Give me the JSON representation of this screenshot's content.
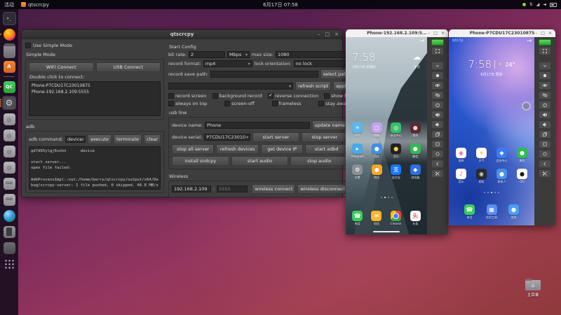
{
  "topbar": {
    "activities": "活动",
    "app_name": "qtscrcpy",
    "clock": "6月17日 07:58"
  },
  "window_controls": {
    "minimize": "–",
    "maximize": "□",
    "close": "×"
  },
  "dock": {
    "items": [
      {
        "name": "terminal",
        "base": "terminal",
        "text": ">_"
      },
      {
        "name": "firefox",
        "base": "firefox",
        "dots": 1
      },
      {
        "name": "files",
        "base": "files"
      },
      {
        "name": "software",
        "base": "software",
        "text": "A"
      },
      {
        "name": "separator"
      },
      {
        "name": "qtcreator",
        "base": "qtcreator",
        "text": "QC",
        "dots": 1
      },
      {
        "name": "qtscrcpy",
        "base": "qtscrcpy",
        "text": "⚙",
        "active": true,
        "dots": 4
      },
      {
        "name": "disk-1",
        "base": "disk",
        "text": "◎"
      },
      {
        "name": "disk-2",
        "base": "disk",
        "text": "◎"
      },
      {
        "name": "disk-3",
        "base": "disk",
        "text": "◎"
      },
      {
        "name": "disk-4",
        "base": "disk",
        "text": "◎"
      },
      {
        "name": "ssd-1",
        "base": "ssd",
        "text": "SSD"
      },
      {
        "name": "ssd-2",
        "base": "ssd",
        "text": "SSD"
      },
      {
        "name": "globe",
        "base": "globe"
      },
      {
        "name": "phone-device",
        "base": "phonedev"
      },
      {
        "name": "drive",
        "base": "drive"
      },
      {
        "name": "show-apps",
        "base": "apps"
      }
    ]
  },
  "desktop": {
    "home_folder_label": "主目录"
  },
  "main_window": {
    "title": "qtscrcpy",
    "left": {
      "use_simple_mode": "Use Simple Mode",
      "simple_mode": "Simple Mode",
      "wifi_connect": "WIFI Connect",
      "usb_connect": "USB Connect",
      "double_click_hint": "Double click to connect:",
      "device_list": [
        "Phone-P7CDU17C23010875",
        "Phone-192.168.2.109:5555"
      ],
      "adb_title": "adb",
      "adb_command_label": "adb command:",
      "adb_command_value": "devices",
      "execute": "execute",
      "terminate": "terminate",
      "clear": "clear",
      "log": [
        "gd7d65ylgj6xnhn      device",
        "",
        "start server...",
        "open file failed:",
        "",
        "AdbProcessImpl::out:/home/barry/qtscrcpy/output/x64/Debug/scrcpy-server: 1 file pushed, 0 skipped. 46.8 MB/s (40667 bytes in 0.001s)"
      ]
    },
    "right": {
      "start_config": "Start Config",
      "bit_rate_label": "bit rate:",
      "bit_rate_value": "2",
      "bit_rate_unit": "Mbps",
      "max_size_label": "max size:",
      "max_size_value": "1080",
      "record_format_label": "record format:",
      "record_format_value": "mp4",
      "lock_orientation_label": "lock orientation:",
      "lock_orientation_value": "no lock",
      "record_save_path_label": "record save path:",
      "record_save_path_value": "",
      "select_path": "select path",
      "script_combo_value": "",
      "refresh_script": "refresh script",
      "apply": "apply",
      "checks1": [
        {
          "label": "record screen",
          "checked": false
        },
        {
          "label": "background record",
          "checked": false
        },
        {
          "label": "reverse connection",
          "checked": true
        },
        {
          "label": "show fps",
          "checked": false
        }
      ],
      "checks2": [
        {
          "label": "always on top",
          "checked": false
        },
        {
          "label": "screen-off",
          "checked": false
        },
        {
          "label": "frameless",
          "checked": false
        },
        {
          "label": "stay awake",
          "checked": false
        }
      ],
      "usb_line": "usb line",
      "device_name_label": "device name:",
      "device_name_value": "Phone",
      "update_name": "update name",
      "device_serial_label": "device serial:",
      "device_serial_value": "P7CDU17C23010",
      "start_server": "start server",
      "stop_server": "stop server",
      "stop_all_server": "stop all server",
      "refresh_devices": "refresh devices",
      "get_device_ip": "get device IP",
      "start_adbd": "start adbd",
      "install_sndcpy": "install sndcpy",
      "start_audio": "start audio",
      "stop_audio": "stop audio",
      "wireless_title": "Wireless",
      "ip_value": "192.168.2.109",
      "colon": ":",
      "port_placeholder": "5555",
      "wireless_connect": "wireless connect",
      "wireless_disconnect": "wireless disconnect"
    }
  },
  "phone_toolbar": {
    "icons": [
      "fullscreen",
      "expand-notify",
      "screenshot-ball",
      "screen-on",
      "screen-off",
      "power",
      "volume-up",
      "volume-down",
      "app-switch",
      "menu",
      "home",
      "back",
      "screenshot"
    ]
  },
  "phone1": {
    "title": "Phone-192.168.2.109:5...",
    "clock": "7:58",
    "date": "6月17日 星期四",
    "weather_icon": "☁",
    "weather_text": "多云",
    "page_dots": 4,
    "active_dot": 1,
    "app_rows": [
      [
        {
          "name": "weather",
          "bg": "#58b7f0",
          "g": "☀",
          "gc": "#fff6c4",
          "label": "天气"
        },
        {
          "name": "gallery",
          "bg": "#c7a1ef",
          "g": "◻",
          "gc": "#ffffff",
          "label": "相册"
        },
        {
          "name": "security",
          "bg": "#35c06a",
          "g": "◎",
          "gc": "#ffffff",
          "label": "安全中心"
        },
        {
          "name": "camera",
          "bg": "#5a2a33",
          "g": "●",
          "gc": "#e8d0d4",
          "label": "相机"
        }
      ],
      [
        {
          "name": "telegram",
          "bg": "#4aa8e8",
          "g": "▸",
          "gc": "#ffffff",
          "label": "Telegram"
        },
        {
          "name": "qq-browser",
          "bg": "#3f8fe8",
          "g": "●",
          "gc": "#ffffff",
          "label": "QQ"
        },
        {
          "name": "qq",
          "bg": "#222222",
          "g": "●",
          "gc": "#f8d048",
          "label": "音乐"
        },
        {
          "name": "wechat",
          "bg": "#2ebd52",
          "g": "●",
          "gc": "#ffffff",
          "label": "微信"
        }
      ],
      [
        {
          "name": "settings",
          "bg": "#8a9097",
          "g": "⚙",
          "gc": "#ffffff",
          "label": "设置"
        },
        {
          "name": "app-store",
          "bg": "#f5a623",
          "g": "●",
          "gc": "#ffffff",
          "label": "商店"
        },
        {
          "name": "alipay",
          "bg": "#1677ff",
          "g": "支",
          "gc": "#ffffff",
          "label": "支付宝"
        },
        {
          "name": "browser-blue",
          "bg": "#2f6fe4",
          "g": "◆",
          "gc": "#ffffff",
          "label": "浏览器"
        }
      ]
    ],
    "dock_apps": [
      {
        "name": "phone",
        "bg": "#3ecb5d",
        "g": "☎",
        "gc": "#ffffff",
        "label": "电话"
      },
      {
        "name": "messages",
        "bg": "#f7b733",
        "g": "✉",
        "gc": "#ffffff",
        "label": "短信"
      },
      {
        "name": "chrome",
        "bg": "",
        "g": "",
        "gc": "",
        "label": "Chrome",
        "cls": "app-chrome"
      },
      {
        "name": "toutiao",
        "bg": "#f5f5f5",
        "g": "头",
        "gc": "#e03a3a",
        "label": "头条"
      }
    ]
  },
  "phone2": {
    "title": "Phone-P7CDU17C23010875",
    "status_left": "6月17日",
    "clock": "7:58",
    "sun_icon": "☀",
    "temp": "24°",
    "date": "6月17日 周四",
    "page_dots": 5,
    "active_dot": 2,
    "app_rows": [
      [
        {
          "name": "gallery",
          "bg": "#ffffff",
          "g": "◉",
          "gc": "#e86aa0",
          "label": "图库"
        },
        {
          "name": "weather",
          "bg": "#ffffff",
          "g": "☀",
          "gc": "#f5b731",
          "label": "天气"
        },
        {
          "name": "member-center",
          "bg": "#3a7bf5",
          "g": "◆",
          "gc": "#ffffff",
          "label": "会员中心"
        },
        {
          "name": "wechat",
          "bg": "#2ebd52",
          "g": "●",
          "gc": "#ffffff",
          "label": "微信"
        }
      ],
      [
        {
          "name": "music",
          "bg": "#ffffff",
          "g": "♪",
          "gc": "#e8558f",
          "label": "音乐"
        },
        {
          "name": "camera",
          "bg": "#2b2b2b",
          "g": "◉",
          "gc": "#cfd8dc",
          "label": "相机"
        },
        {
          "name": "contacts",
          "bg": "#4a90e8",
          "g": "●",
          "gc": "#ffffff",
          "label": "联系人"
        },
        {
          "name": "qq",
          "bg": "#ffffff",
          "g": "●",
          "gc": "#1a1a1a",
          "label": "QQ"
        }
      ]
    ],
    "dock_apps": [
      {
        "name": "phone",
        "bg": "#3ecb5d",
        "g": "☎",
        "gc": "#ffffff",
        "label": "电话"
      },
      {
        "name": "utilities-folder",
        "bg": "#5a8ff0",
        "g": "▦",
        "gc": "#ffffff",
        "label": "实用工具"
      },
      {
        "name": "messaging",
        "bg": "#4aa0f5",
        "g": "●",
        "gc": "#ffffff",
        "label": "信息"
      }
    ]
  }
}
